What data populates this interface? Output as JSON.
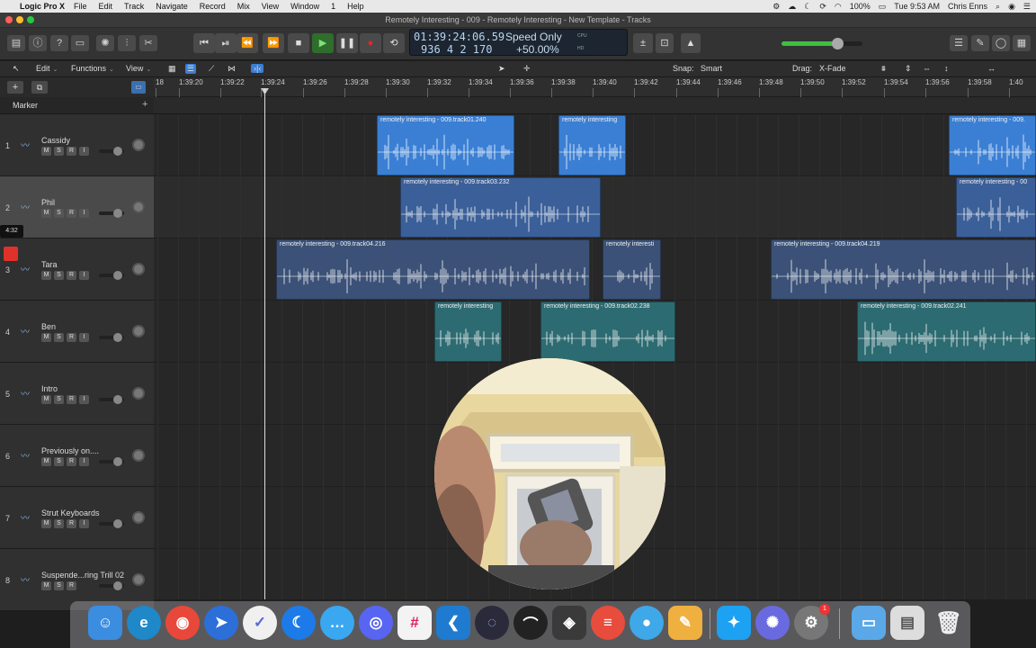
{
  "menubar": {
    "app_name": "Logic Pro X",
    "items": [
      "File",
      "Edit",
      "Track",
      "Navigate",
      "Record",
      "Mix",
      "View",
      "Window",
      "1",
      "Help"
    ],
    "battery": "100%",
    "clock": "Tue 9:53 AM",
    "user": "Chris Enns"
  },
  "window": {
    "title": "Remotely Interesting - 009 - Remotely Interesting - New Template - Tracks"
  },
  "lcd": {
    "timecode": "01:39:24:06.59",
    "bars": "936  4  2  170",
    "mode": "Speed Only",
    "percent": "+50.00%",
    "cpu_label": "CPU",
    "hd_label": "HD"
  },
  "toolbar": {
    "edit_label": "Edit",
    "functions_label": "Functions",
    "view_label": "View",
    "snap_label": "Snap:",
    "snap_value": "Smart",
    "drag_label": "Drag:",
    "drag_value": "X-Fade"
  },
  "ruler": {
    "ticks": [
      "18",
      "1:39:20",
      "1:39:22",
      "1:39:24",
      "1:39:26",
      "1:39:28",
      "1:39:30",
      "1:39:32",
      "1:39:34",
      "1:39:36",
      "1:39:38",
      "1:39:40",
      "1:39:42",
      "1:39:44",
      "1:39:46",
      "1:39:48",
      "1:39:50",
      "1:39:52",
      "1:39:54",
      "1:39:56",
      "1:39:58",
      "1:40"
    ]
  },
  "marker_label": "Marker",
  "time_badge": "4:32",
  "tracks": [
    {
      "num": "1",
      "name": "Cassidy",
      "buttons": [
        "M",
        "S",
        "R",
        "I"
      ]
    },
    {
      "num": "2",
      "name": "Phil",
      "buttons": [
        "M",
        "S",
        "R",
        "I"
      ]
    },
    {
      "num": "3",
      "name": "Tara",
      "buttons": [
        "M",
        "S",
        "R",
        "I"
      ]
    },
    {
      "num": "4",
      "name": "Ben",
      "buttons": [
        "M",
        "S",
        "R",
        "I"
      ]
    },
    {
      "num": "5",
      "name": "Intro",
      "buttons": [
        "M",
        "S",
        "R",
        "I"
      ]
    },
    {
      "num": "6",
      "name": "Previously on....",
      "buttons": [
        "M",
        "S",
        "R",
        "I"
      ]
    },
    {
      "num": "7",
      "name": "Strut Keyboards",
      "buttons": [
        "M",
        "S",
        "R",
        "I"
      ]
    },
    {
      "num": "8",
      "name": "Suspende...ring Trill 02",
      "buttons": [
        "M",
        "S",
        "R"
      ]
    }
  ],
  "regions": [
    {
      "lane": 0,
      "name": "remotely interesting - 009.track01.240",
      "color": "#3a7fd4"
    },
    {
      "lane": 0,
      "name": "remotely interesting",
      "color": "#3a7fd4"
    },
    {
      "lane": 0,
      "name": "remotely interesting - 009.",
      "color": "#3a7fd4"
    },
    {
      "lane": 1,
      "name": "remotely interesting - 009.track03.232",
      "color": "#3b5f98"
    },
    {
      "lane": 1,
      "name": "remotely interesting - 00",
      "color": "#3b5f98"
    },
    {
      "lane": 2,
      "name": "remotely interesting - 009.track04.216",
      "color": "#3b5177"
    },
    {
      "lane": 2,
      "name": "remotely interesti",
      "color": "#3b5177"
    },
    {
      "lane": 2,
      "name": "remotely interesting - 009.track04.219",
      "color": "#3b5177"
    },
    {
      "lane": 3,
      "name": "remotely interesting",
      "color": "#2d6b72"
    },
    {
      "lane": 3,
      "name": "remotely interesting - 009.track02.238",
      "color": "#2d6b72"
    },
    {
      "lane": 3,
      "name": "remotely interesting - 009.track02.241",
      "color": "#2d6b72"
    }
  ],
  "dock": {
    "apps": [
      "Finder",
      "Microsoft Edge",
      "Google Chrome",
      "Spark",
      "OmniFocus",
      "Reeder",
      "Messages",
      "Discord",
      "Slack",
      "Visual Studio Code",
      "Logic Pro X",
      "Ubiquiti",
      "Compressor",
      "Fantastical",
      "Tweetbot",
      "Pixelmator",
      "Twitter",
      "Perplexity",
      "System Preferences",
      "Downloads",
      "Documents",
      "Trash"
    ],
    "prefs_badge": "1"
  }
}
